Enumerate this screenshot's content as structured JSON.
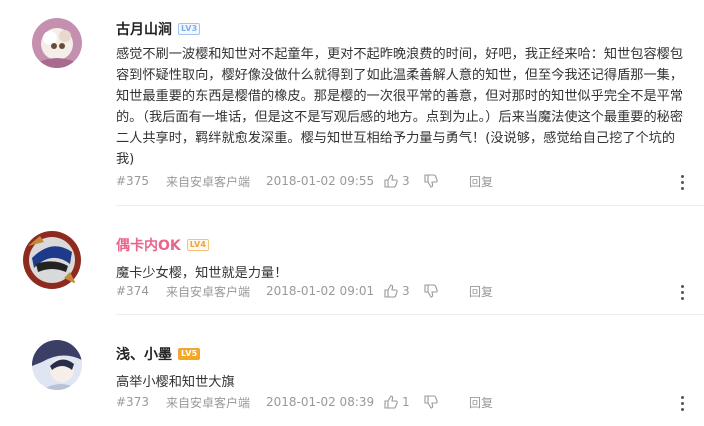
{
  "comments": [
    {
      "username": "古月山涧",
      "level": "LV3",
      "text": "感觉不刷一波樱和知世对不起童年，更对不起昨晚浪费的时间，好吧，我正经来哈：知世包容樱包容到怀疑性取向，樱好像没做什么就得到了如此温柔善解人意的知世，但至今我还记得盾那一集，知世最重要的东西是樱借的橡皮。那是樱的一次很平常的善意，但对那时的知世似乎完全不是平常的。（我后面有一堆话，但是这不是写观后感的地方。点到为止。）后来当魔法使这个最重要的秘密二人共享时，羁绊就愈发深重。樱与知世互相给予力量与勇气！(没说够，感觉给自己挖了个坑的我)",
      "floor": "#375",
      "source": "来自安卓客户端",
      "time": "2018-01-02 09:55",
      "likes": "3",
      "reply": "回复"
    },
    {
      "username": "偶卡内OK",
      "level": "LV4",
      "text": "魔卡少女樱，知世就是力量！",
      "floor": "#374",
      "source": "来自安卓客户端",
      "time": "2018-01-02 09:01",
      "likes": "3",
      "reply": "回复"
    },
    {
      "username": "浅、小墨",
      "level": "LV5",
      "text": "高举小樱和知世大旗",
      "floor": "#373",
      "source": "来自安卓客户端",
      "time": "2018-01-02 08:39",
      "likes": "1",
      "reply": "回复"
    }
  ],
  "colors": {
    "username_highlight": "#e9658c",
    "meta_text": "#999999"
  }
}
